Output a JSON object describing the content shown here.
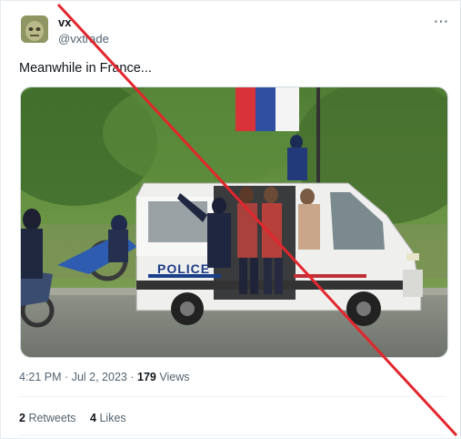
{
  "tweet": {
    "author_name": "vx",
    "author_handle": "@vxtrade",
    "text": "Meanwhile in France...",
    "media_van_text": "POLICE",
    "time": "4:21 PM",
    "separator": "·",
    "date": "Jul 2, 2023",
    "views_count": "179",
    "views_label": "Views",
    "retweets_count": "2",
    "retweets_label": "Retweets",
    "likes_count": "4",
    "likes_label": "Likes"
  },
  "icons": {
    "more": "more-options-icon",
    "avatar": "avatar",
    "overlay": "red-cross-line"
  },
  "colors": {
    "cross_line": "#e3262d",
    "secondary_text": "#536471",
    "primary_text": "#0f1419"
  }
}
